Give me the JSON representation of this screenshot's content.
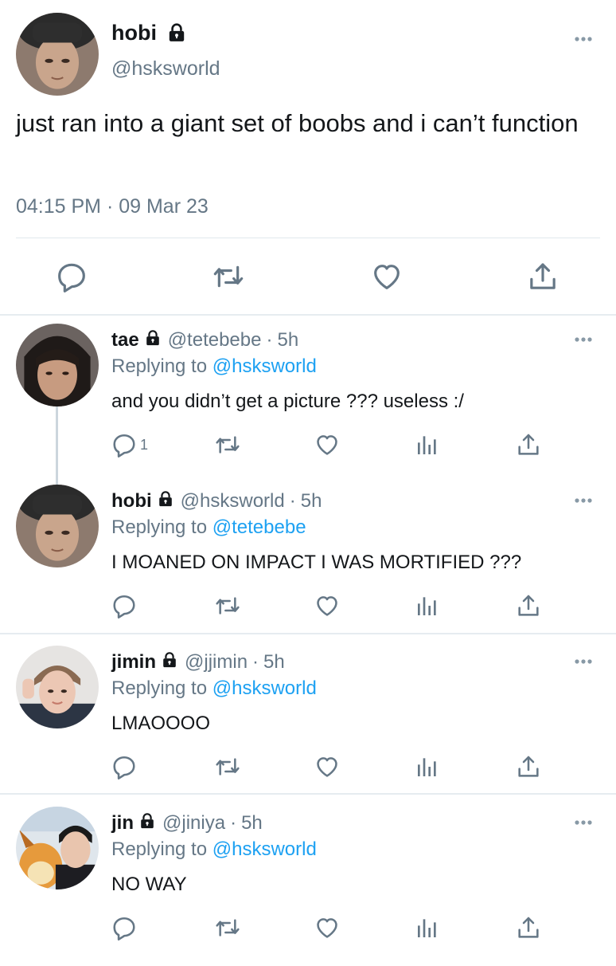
{
  "colors": {
    "text": "#14171a",
    "muted": "#657786",
    "link": "#1da1f2",
    "divider": "#e1e8ed"
  },
  "main_tweet": {
    "name": "hobi",
    "handle": "@hsksworld",
    "text": "just ran into a giant set of boobs and i can’t function",
    "timestamp": "04:15 PM · 09 Mar 23",
    "icons": [
      "lock-icon",
      "more-icon",
      "reply-icon",
      "retweet-icon",
      "like-icon",
      "share-icon"
    ]
  },
  "replies": [
    {
      "name": "tae",
      "handle": "@tetebebe",
      "separator": "·",
      "time": "5h",
      "replying_prefix": "Replying to",
      "replying_to": "@hsksworld",
      "text": "and you didn’t get a picture ??? useless :/",
      "reply_count": "1",
      "avatar": "avatar-photo"
    },
    {
      "name": "hobi",
      "handle": "@hsksworld",
      "separator": "·",
      "time": "5h",
      "replying_prefix": "Replying to",
      "replying_to": "@tetebebe",
      "text": "I MOANED ON IMPACT I WAS MORTIFIED ???",
      "reply_count": "",
      "avatar": "avatar-photo"
    },
    {
      "name": "jimin",
      "handle": "@jjimin",
      "separator": "·",
      "time": "5h",
      "replying_prefix": "Replying to",
      "replying_to": "@hsksworld",
      "text": "LMAOOOO",
      "reply_count": "",
      "avatar": "avatar-photo"
    },
    {
      "name": "jin",
      "handle": "@jiniya",
      "separator": "·",
      "time": "5h",
      "replying_prefix": "Replying to",
      "replying_to": "@hsksworld",
      "text": "NO WAY",
      "reply_count": "",
      "avatar": "avatar-photo"
    }
  ]
}
